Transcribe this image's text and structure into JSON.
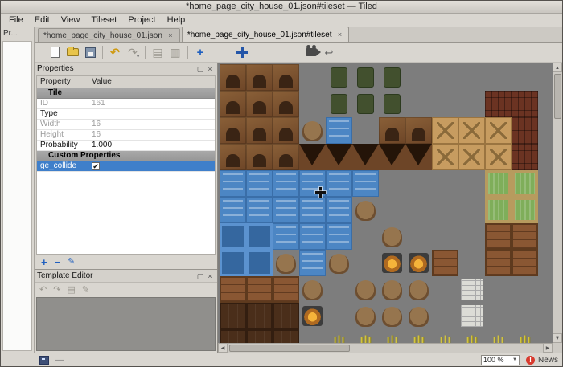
{
  "window": {
    "title": "*home_page_city_house_01.json#tileset — Tiled"
  },
  "menubar": {
    "items": [
      "File",
      "Edit",
      "View",
      "Tileset",
      "Project",
      "Help"
    ]
  },
  "projects_dock": {
    "title": "Pr..."
  },
  "tabbar": {
    "close_glyph": "×",
    "tabs": [
      {
        "label": "*home_page_city_house_01.json",
        "active": false
      },
      {
        "label": "*home_page_city_house_01.json#tileset",
        "active": true
      }
    ]
  },
  "toolbar": {
    "items": [
      {
        "name": "new-file",
        "kind": "doc"
      },
      {
        "name": "open-file",
        "kind": "folder"
      },
      {
        "name": "save-file",
        "kind": "disk"
      },
      {
        "kind": "sep"
      },
      {
        "name": "undo",
        "kind": "undo"
      },
      {
        "name": "redo",
        "kind": "redo",
        "disabled": true,
        "caret": true
      },
      {
        "kind": "sep"
      },
      {
        "name": "copy",
        "kind": "copy",
        "disabled": true
      },
      {
        "name": "paste",
        "kind": "paste",
        "disabled": true
      },
      {
        "kind": "sep"
      },
      {
        "name": "add-tiles",
        "kind": "plus"
      },
      {
        "kind": "spacer"
      },
      {
        "name": "move-tiles",
        "kind": "move"
      },
      {
        "kind": "spacer2"
      },
      {
        "name": "tile-animation-editor",
        "kind": "camera"
      },
      {
        "name": "rearrange-tiles",
        "kind": "swap"
      }
    ]
  },
  "properties_panel": {
    "title": "Properties",
    "columns": [
      "Property",
      "Value"
    ],
    "rows": [
      {
        "kind": "group",
        "label": "Tile"
      },
      {
        "kind": "item",
        "property": "ID",
        "value": "161",
        "dim": true
      },
      {
        "kind": "item",
        "property": "Type",
        "value": "",
        "dim": false
      },
      {
        "kind": "item",
        "property": "Width",
        "value": "16",
        "dim": true
      },
      {
        "kind": "item",
        "property": "Height",
        "value": "16",
        "dim": true
      },
      {
        "kind": "item",
        "property": "Probability",
        "value": "1.000",
        "dim": false
      },
      {
        "kind": "group",
        "label": "Custom Properties"
      },
      {
        "kind": "item",
        "property": "ge_collide",
        "checkbox": true,
        "checked": true,
        "selected": true
      }
    ],
    "footer": {
      "add": "+",
      "remove": "−",
      "edit": "✎"
    },
    "check_glyph": "✔"
  },
  "template_editor": {
    "title": "Template Editor",
    "toolbar": [
      {
        "name": "undo",
        "glyph": "↶"
      },
      {
        "name": "redo",
        "glyph": "↷"
      },
      {
        "name": "duplicate",
        "glyph": "▤"
      },
      {
        "name": "edit",
        "glyph": "✎"
      }
    ]
  },
  "tileset": {
    "grid": [
      "CCC.MMM.....",
      "CCC.MMM...RR",
      "CCCSW.CCTTTR",
      "CCCDDDDDTTTR",
      "WWWWWW....GG",
      "WWWWWS....GG",
      "PPWWW.S...BB",
      "PPSWS.OOB.BB",
      "BBBS.SSS.L..",
      "FFFO.SSS.L..",
      "FFF.YYYYYYYY"
    ],
    "legend": {
      "C": "cave-wall",
      "D": "cave-opening",
      "W": "water",
      "P": "water-pool",
      "T": "wood-floor",
      "M": "military-vehicle",
      "R": "brick-building",
      "G": "moss-plate",
      "B": "furniture",
      "F": "dark-cabinet",
      "S": "rock-mound",
      "O": "fire-light",
      "Y": "grass-tuft",
      "L": "lattice",
      ".": "empty"
    }
  },
  "statusbar": {
    "dash": "—",
    "zoom": "100 %",
    "news_label": "News",
    "news_badge": "!"
  },
  "dock_buttons": {
    "float": "▢",
    "close": "×"
  }
}
